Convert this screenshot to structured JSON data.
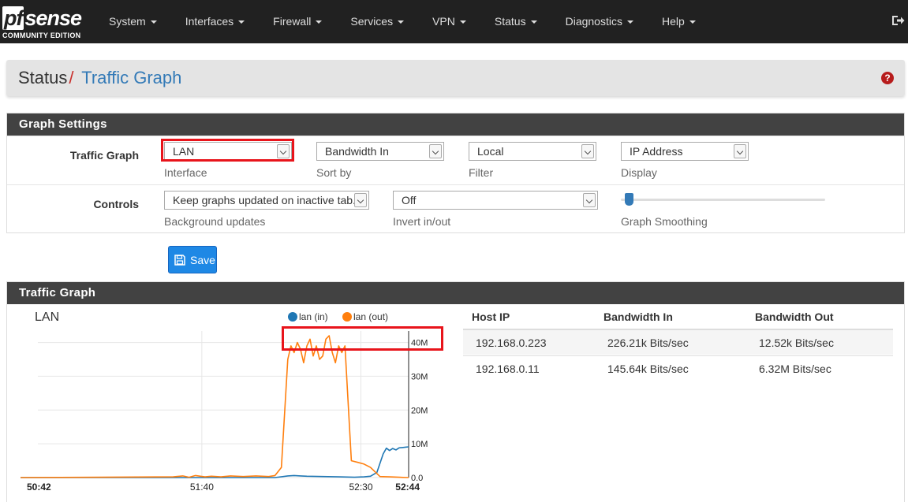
{
  "navbar": {
    "logo_main": "sense",
    "logo_pf": "pf",
    "logo_sub": "COMMUNITY EDITION",
    "items": [
      {
        "label": "System"
      },
      {
        "label": "Interfaces"
      },
      {
        "label": "Firewall"
      },
      {
        "label": "Services"
      },
      {
        "label": "VPN"
      },
      {
        "label": "Status"
      },
      {
        "label": "Diagnostics"
      },
      {
        "label": "Help"
      }
    ]
  },
  "breadcrumb": {
    "parent": "Status",
    "separator": "/",
    "current": "Traffic Graph",
    "help": "?"
  },
  "settings": {
    "title": "Graph Settings",
    "traffic_label": "Traffic Graph",
    "interface": {
      "value": "LAN",
      "hint": "Interface"
    },
    "sort": {
      "value": "Bandwidth In",
      "hint": "Sort by"
    },
    "filter": {
      "value": "Local",
      "hint": "Filter"
    },
    "display": {
      "value": "IP Address",
      "hint": "Display"
    },
    "controls_label": "Controls",
    "background": {
      "value": "Keep graphs updated on inactive tab.",
      "hint": "Background updates"
    },
    "invert": {
      "value": "Off",
      "hint": "Invert in/out"
    },
    "smoothing": {
      "hint": "Graph Smoothing",
      "level": 0.02
    },
    "save_label": "Save"
  },
  "traffic": {
    "title": "Traffic Graph",
    "graph_title": "LAN",
    "legend_in": "lan (in)",
    "legend_out": "lan (out)"
  },
  "chart_data": {
    "type": "line",
    "title": "LAN",
    "x_ticks": [
      "50:42",
      "51:40",
      "52:30",
      "52:44"
    ],
    "y_ticks": [
      "0.0",
      "10M",
      "20M",
      "30M",
      "40M"
    ],
    "ylim": [
      0,
      42
    ],
    "xlim": [
      0,
      122
    ],
    "grid": true,
    "legend": "top",
    "series": [
      {
        "name": "lan (in)",
        "color": "#1f77b4",
        "x": [
          0,
          50,
          60,
          70,
          80,
          84,
          86,
          88,
          90,
          95,
          100,
          105,
          108,
          110,
          112,
          114,
          115,
          116,
          117,
          118,
          119,
          120,
          121,
          122
        ],
        "y": [
          0,
          0,
          0,
          0,
          0,
          0.5,
          0.6,
          0.5,
          0.4,
          0.3,
          0.2,
          0.1,
          0.2,
          0.4,
          1.5,
          7,
          8.7,
          8.0,
          8.6,
          8.2,
          8.8,
          8.9,
          9.0,
          9.1
        ]
      },
      {
        "name": "lan (out)",
        "color": "#ff7f0e",
        "x": [
          0,
          48,
          51,
          53,
          55,
          58,
          60,
          63,
          66,
          70,
          74,
          78,
          80,
          82,
          84,
          85,
          86,
          87,
          88,
          89,
          90,
          91,
          92,
          93,
          94,
          95,
          96,
          97,
          98,
          99,
          100,
          101,
          102,
          104,
          106,
          108,
          110,
          113,
          116,
          119,
          122
        ],
        "y": [
          0,
          0.2,
          0.5,
          0.1,
          0.6,
          0.2,
          0.4,
          0.2,
          0.5,
          0.3,
          0.5,
          0.3,
          0.6,
          3,
          35,
          39,
          37,
          40,
          38,
          34,
          39,
          41,
          36,
          39,
          35,
          36,
          41,
          42,
          37,
          34,
          39,
          37,
          39,
          5,
          4.5,
          4,
          3,
          0.3,
          0.2,
          0.1,
          0
        ]
      }
    ]
  },
  "hosts": {
    "headers": [
      "Host IP",
      "Bandwidth In",
      "Bandwidth Out"
    ],
    "rows": [
      {
        "ip": "192.168.0.223",
        "in": "226.21k Bits/sec",
        "out": "12.52k Bits/sec"
      },
      {
        "ip": "192.168.0.11",
        "in": "145.64k Bits/sec",
        "out": "6.32M Bits/sec"
      }
    ]
  }
}
